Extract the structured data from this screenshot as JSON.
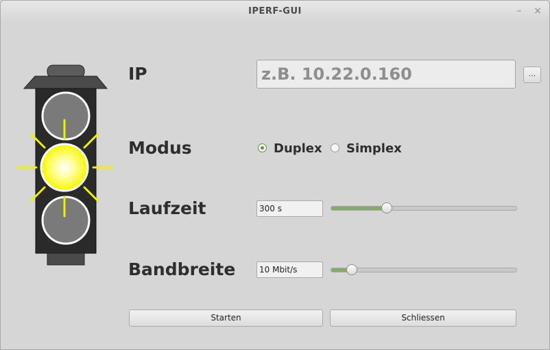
{
  "window": {
    "title": "IPERF-GUI",
    "minimize_glyph": "–",
    "close_glyph": "×"
  },
  "traffic_light": {
    "active_lamp": "yellow",
    "lamps": [
      "off",
      "yellow",
      "off"
    ],
    "colors": {
      "housing": "#2a2a2a",
      "off": "#7a7a7a",
      "yellow": "#ffff40",
      "rays": "#f0f000"
    }
  },
  "form": {
    "ip": {
      "label": "IP",
      "value": "",
      "placeholder": "z.B. 10.22.0.160",
      "browse_label": "..."
    },
    "mode": {
      "label": "Modus",
      "options": [
        {
          "label": "Duplex",
          "checked": true
        },
        {
          "label": "Simplex",
          "checked": false
        }
      ]
    },
    "duration": {
      "label": "Laufzeit",
      "value_text": "300 s",
      "slider_fraction": 0.3
    },
    "bandwidth": {
      "label": "Bandbreite",
      "value_text": "10 Mbit/s",
      "slider_fraction": 0.11
    }
  },
  "buttons": {
    "start": "Starten",
    "close": "Schliessen"
  },
  "colors": {
    "accent": "#87a96b",
    "background": "#d6d6d6",
    "text": "#2e2e2e"
  }
}
